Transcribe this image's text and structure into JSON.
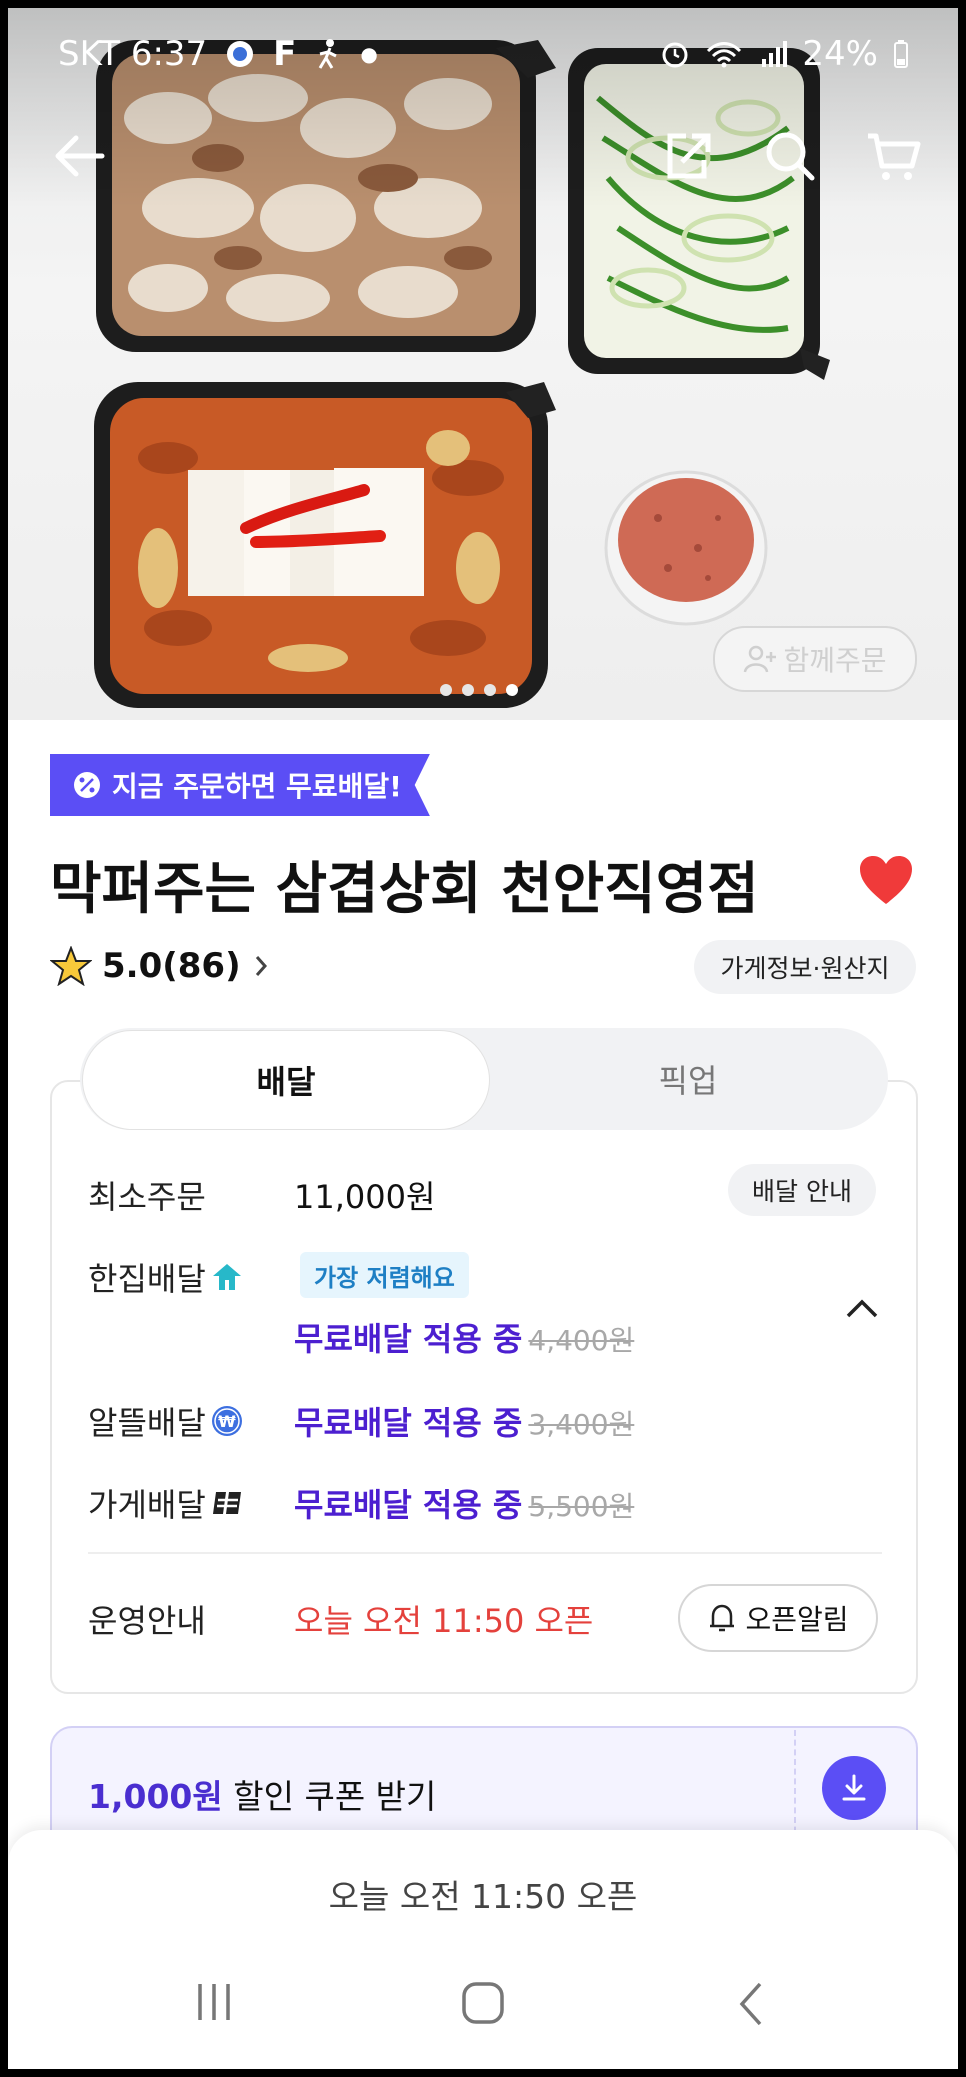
{
  "status_bar": {
    "carrier_time": "SKT 6:37",
    "battery": "24%"
  },
  "hero": {
    "together_order_label": "함께주문",
    "page_dots": 4,
    "active_dot": 3
  },
  "promo_banner": "지금 주문하면 무료배달!",
  "store": {
    "name": "막퍼주는 삼겹상회 천안직영점",
    "rating": "5.0(86)",
    "info_button": "가게정보·원산지",
    "favorited": true
  },
  "tabs": {
    "delivery": "배달",
    "pickup": "픽업"
  },
  "delivery_info": {
    "min_order_label": "최소주문",
    "min_order_value": "11,000원",
    "delivery_guide_button": "배달 안내",
    "options": [
      {
        "name": "한집배달",
        "badge": "가장 저렴해요",
        "status": "무료배달 적용 중",
        "original_fee": "4,400원",
        "icon": "house-arrow-icon"
      },
      {
        "name": "알뜰배달",
        "status": "무료배달 적용 중",
        "original_fee": "3,400원",
        "icon": "won-coin-icon"
      },
      {
        "name": "가게배달",
        "status": "무료배달 적용 중",
        "original_fee": "5,500원",
        "icon": "store-delivery-icon"
      }
    ],
    "hours_label": "운영안내",
    "hours_value": "오늘 오전 11:50 오픈",
    "open_alarm_button": "오픈알림"
  },
  "coupon": {
    "amount": "1,000원",
    "text": "할인 쿠폰 받기"
  },
  "bottom_bar": {
    "text": "오늘 오전 11:50 오픈"
  },
  "colors": {
    "accent": "#5b4ef5",
    "free_delivery": "#4c1fd0",
    "open_time": "#e4413c",
    "heart": "#f03a3a"
  }
}
